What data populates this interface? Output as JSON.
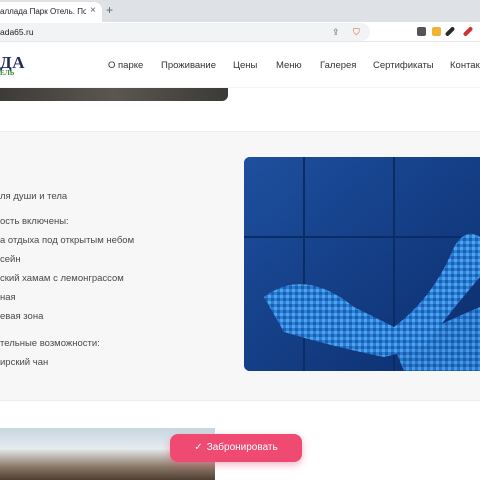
{
  "browser": {
    "tab_title": "аллада Парк Отель. Полно",
    "tab_close": "×",
    "new_tab": "+",
    "url": "ada65.ru",
    "share_icon": "share-icon",
    "shield_icon": "brave-shield-icon"
  },
  "header": {
    "logo": "ДА",
    "logo_sub": "ЕЛЬ",
    "nav": [
      "О парке",
      "Проживание",
      "Цены",
      "Меню",
      "Галерея",
      "Сертификаты",
      "Контакты"
    ]
  },
  "content": {
    "lines": [
      "ля души и тела",
      "ость включены:",
      "а отдыха под открытым небом",
      "сейн",
      "ский хамам с лемонграссом",
      "ная",
      "евая зона",
      "тельные возможности:",
      "ирский чан"
    ]
  },
  "book_button": {
    "label": "Забронировать",
    "icon": "check-icon"
  },
  "colors": {
    "accent": "#ee4a72",
    "logo": "#1f2f5c",
    "logo_sub": "#3a8a3a",
    "photo": "#1d5fb8"
  }
}
